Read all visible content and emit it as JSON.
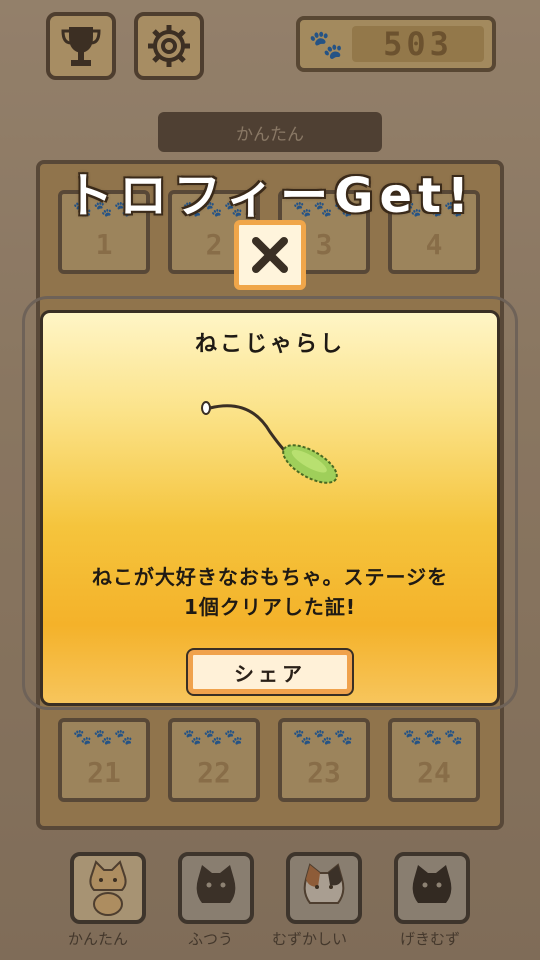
{
  "coins": "503",
  "difficulty_label": "かんたん",
  "stages_top": [
    {
      "paws": "🐾🐾🐾",
      "number": "1"
    },
    {
      "paws": "🐾🐾🐾",
      "number": "2"
    },
    {
      "paws": "🐾🐾🐾",
      "number": "3"
    },
    {
      "paws": "🐾🐾🐾",
      "number": "4"
    }
  ],
  "stages_bottom": [
    {
      "paws": "🐾🐾🐾",
      "number": "21"
    },
    {
      "paws": "🐾🐾🐾",
      "number": "22"
    },
    {
      "paws": "🐾🐾🐾",
      "number": "23"
    },
    {
      "paws": "🐾🐾🐾",
      "number": "24"
    }
  ],
  "modes": [
    {
      "label": "かんたん",
      "icon": "tabby-cat-icon"
    },
    {
      "label": "ふつう",
      "icon": "black-cat-icon"
    },
    {
      "label": "むずかしい",
      "icon": "calico-cat-icon"
    },
    {
      "label": "げきむず",
      "icon": "black-cat-icon"
    }
  ],
  "popup": {
    "title": "トロフィーGet!",
    "item_name": "ねこじゃらし",
    "description_line1": "ねこが大好きなおもちゃ。ステージを",
    "description_line2": "1個クリアした証!",
    "share_label": "シェア",
    "close_glyph": "✕"
  },
  "icons": {
    "trophy": "trophy-icon",
    "settings": "gear-icon",
    "paw": "paw-icon",
    "toy": "cat-teaser-toy-icon"
  },
  "colors": {
    "accent_orange": "#f0a64a",
    "card_yellow": "#f5c43c",
    "outline_dark": "#3a2f24"
  }
}
